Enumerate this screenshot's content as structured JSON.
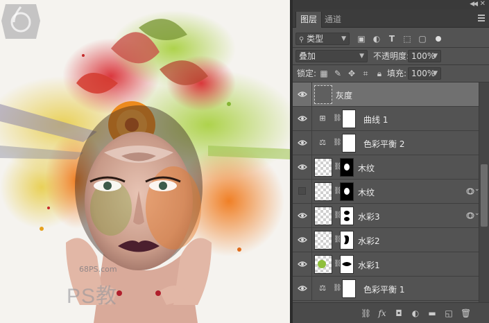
{
  "canvas": {
    "watermark_site": "68PS.com",
    "watermark_brand": "PS教"
  },
  "panel": {
    "tabs": [
      {
        "label": "图层",
        "active": true
      },
      {
        "label": "通道",
        "active": false
      }
    ],
    "filter": {
      "kind_label": "类型"
    },
    "blend_mode": "叠加",
    "opacity_label": "不透明度:",
    "opacity_value": "100%",
    "lock_label": "锁定:",
    "fill_label": "填充:",
    "fill_value": "100%",
    "layers": [
      {
        "name": "灰度",
        "type": "smart-filter-group",
        "visible": true,
        "selected": true
      },
      {
        "name": "曲线 1",
        "type": "curves",
        "visible": true,
        "selected": false
      },
      {
        "name": "色彩平衡 2",
        "type": "color-balance",
        "visible": true,
        "selected": false
      },
      {
        "name": "木纹",
        "type": "image-mask",
        "visible": true,
        "selected": false
      },
      {
        "name": "木纹",
        "type": "image-mask",
        "visible": false,
        "selected": false,
        "fx": true
      },
      {
        "name": "水彩3",
        "type": "image-mask",
        "visible": true,
        "selected": false,
        "fx": true
      },
      {
        "name": "水彩2",
        "type": "image-mask",
        "visible": true,
        "selected": false
      },
      {
        "name": "水彩1",
        "type": "image-mask",
        "visible": true,
        "selected": false
      },
      {
        "name": "色彩平衡 1",
        "type": "color-balance",
        "visible": true,
        "selected": false
      }
    ],
    "footer_icons": [
      "link-icon",
      "fx-icon",
      "add-mask-icon",
      "adjustment-icon",
      "folder-icon",
      "new-layer-icon",
      "trash-icon"
    ]
  }
}
